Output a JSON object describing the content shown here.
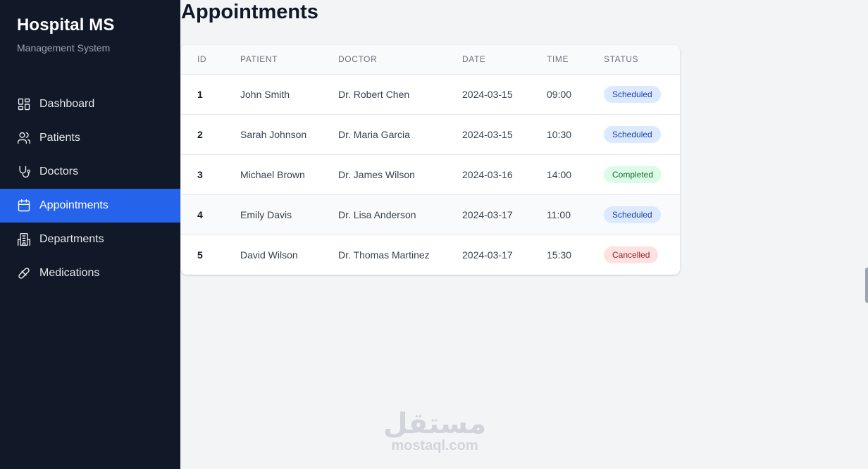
{
  "sidebar": {
    "title": "Hospital MS",
    "subtitle": "Management System",
    "items": [
      {
        "label": "Dashboard",
        "icon": "dashboard-icon"
      },
      {
        "label": "Patients",
        "icon": "users-icon"
      },
      {
        "label": "Doctors",
        "icon": "stethoscope-icon"
      },
      {
        "label": "Appointments",
        "icon": "calendar-icon",
        "active": true
      },
      {
        "label": "Departments",
        "icon": "building-icon"
      },
      {
        "label": "Medications",
        "icon": "pill-icon"
      }
    ]
  },
  "main": {
    "title": "Appointments",
    "table": {
      "headers": [
        "ID",
        "PATIENT",
        "DOCTOR",
        "DATE",
        "TIME",
        "STATUS"
      ],
      "rows": [
        {
          "id": "1",
          "patient": "John Smith",
          "doctor": "Dr. Robert Chen",
          "date": "2024-03-15",
          "time": "09:00",
          "status": "Scheduled"
        },
        {
          "id": "2",
          "patient": "Sarah Johnson",
          "doctor": "Dr. Maria Garcia",
          "date": "2024-03-15",
          "time": "10:30",
          "status": "Scheduled"
        },
        {
          "id": "3",
          "patient": "Michael Brown",
          "doctor": "Dr. James Wilson",
          "date": "2024-03-16",
          "time": "14:00",
          "status": "Completed"
        },
        {
          "id": "4",
          "patient": "Emily Davis",
          "doctor": "Dr. Lisa Anderson",
          "date": "2024-03-17",
          "time": "11:00",
          "status": "Scheduled"
        },
        {
          "id": "5",
          "patient": "David Wilson",
          "doctor": "Dr. Thomas Martinez",
          "date": "2024-03-17",
          "time": "15:30",
          "status": "Cancelled"
        }
      ]
    }
  },
  "watermark": {
    "arabic": "مستقل",
    "latin": "mostaql.com"
  },
  "colors": {
    "sidebar_bg": "#111827",
    "accent": "#2563eb",
    "scheduled": "#dbeafe",
    "completed": "#dcfce7",
    "cancelled": "#fee2e2"
  }
}
